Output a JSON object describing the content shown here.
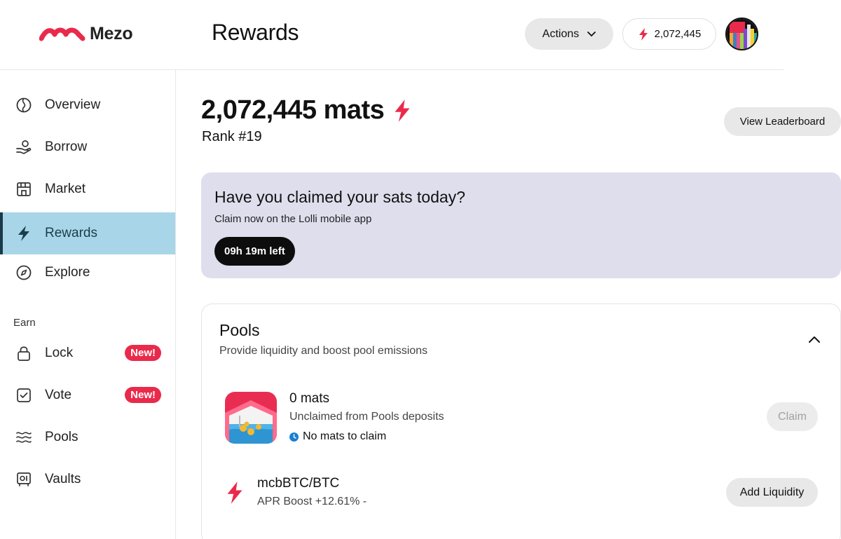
{
  "brand": {
    "name": "Mezo",
    "accent": "#ea2a4b"
  },
  "header": {
    "title": "Rewards",
    "actions_label": "Actions",
    "mats_balance": "2,072,445"
  },
  "sidebar": {
    "items": [
      {
        "label": "Overview",
        "icon": "globe-icon"
      },
      {
        "label": "Borrow",
        "icon": "hand-coins-icon"
      },
      {
        "label": "Market",
        "icon": "storefront-icon"
      },
      {
        "label": "Rewards",
        "icon": "lightning-icon",
        "active": true
      },
      {
        "label": "Explore",
        "icon": "compass-icon"
      }
    ],
    "earn_label": "Earn",
    "earn_items": [
      {
        "label": "Lock",
        "icon": "lock-icon",
        "badge": "New!"
      },
      {
        "label": "Vote",
        "icon": "checkbox-icon",
        "badge": "New!"
      },
      {
        "label": "Pools",
        "icon": "waves-icon"
      },
      {
        "label": "Vaults",
        "icon": "vault-icon"
      }
    ]
  },
  "summary": {
    "mats_total": "2,072,445 mats",
    "rank": "Rank #19",
    "leaderboard_label": "View Leaderboard"
  },
  "claim_banner": {
    "title": "Have you claimed your sats today?",
    "subtitle": "Claim now on the Lolli mobile app",
    "timer": "09h 19m left",
    "background": "#dfdeed"
  },
  "pools": {
    "title": "Pools",
    "subtitle": "Provide liquidity and boost pool emissions",
    "unclaimed": {
      "amount": "0 mats",
      "description": "Unclaimed from Pools deposits",
      "status": "No mats to claim",
      "claim_label": "Claim"
    },
    "rows": [
      {
        "name": "mcbBTC/BTC",
        "apr": "APR Boost +12.61% -",
        "action_label": "Add Liquidity"
      }
    ]
  }
}
